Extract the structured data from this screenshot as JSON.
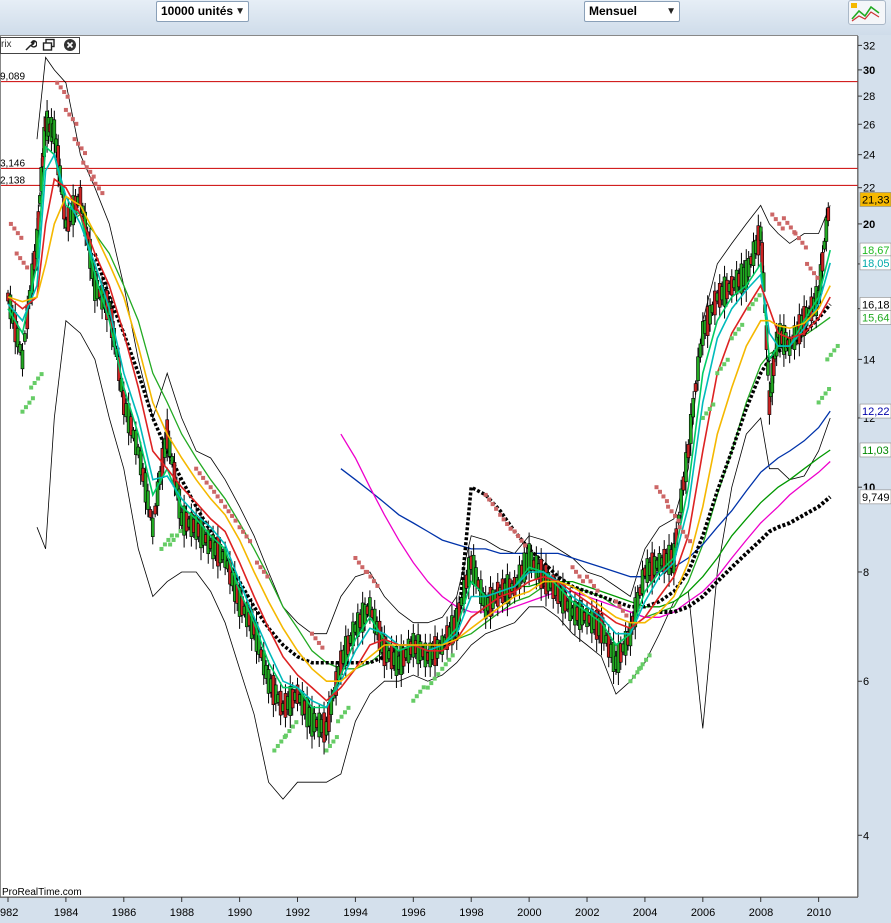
{
  "toolbar": {
    "units_label": "10000 unités",
    "period_label": "Mensuel",
    "dropdown_arrow": "▼",
    "logo_icon": "mini-chart-icon"
  },
  "controls": {
    "label": "rix",
    "icons": [
      "wrench-icon",
      "window-restore-icon",
      "close-circle-icon"
    ]
  },
  "watermark": "ProRealTime.com",
  "chart_data": {
    "type": "line",
    "x_tick_labels": [
      "982",
      "1984",
      "1986",
      "1988",
      "1990",
      "1992",
      "1994",
      "1996",
      "1998",
      "2000",
      "2002",
      "2004",
      "2006",
      "2008",
      "2010"
    ],
    "y_ticks": [
      4,
      6,
      8,
      10,
      12,
      14,
      16,
      18,
      20,
      22,
      24,
      26,
      28,
      30,
      32
    ],
    "y_tick_labels": [
      "4",
      "6",
      "8",
      "10",
      "12",
      "14",
      "",
      "",
      "20",
      "22",
      "24",
      "26",
      "28",
      "30",
      "32"
    ],
    "y_bold_ticks": [
      10,
      20,
      30
    ],
    "xlim": [
      1982,
      2010.6
    ],
    "ylim": [
      3.4,
      32.8
    ],
    "y_scale": "log",
    "horizontal_levels": [
      {
        "value": 29.089,
        "label": "9,089",
        "color": "#cc0000"
      },
      {
        "value": 23.146,
        "label": "3,146",
        "color": "#cc0000"
      },
      {
        "value": 22.138,
        "label": "2,138",
        "color": "#cc0000"
      }
    ],
    "right_badges": [
      {
        "value": 21.33,
        "label": "21,33",
        "bg": "#f5b800",
        "fg": "#000000"
      },
      {
        "value": 18.67,
        "label": "18,67",
        "bg": "#ffffff",
        "fg": "#22bb22"
      },
      {
        "value": 18.05,
        "label": "18,05",
        "bg": "#ffffff",
        "fg": "#00aaaa"
      },
      {
        "value": 16.18,
        "label": "16,18",
        "bg": "#ffffff",
        "fg": "#000000"
      },
      {
        "value": 15.64,
        "label": "15,64",
        "bg": "#ffffff",
        "fg": "#22aa22"
      },
      {
        "value": 12.22,
        "label": "12,22",
        "bg": "#ffffff",
        "fg": "#0000aa"
      },
      {
        "value": 11.03,
        "label": "11,03",
        "bg": "#ffffff",
        "fg": "#008800"
      },
      {
        "value": 9.749,
        "label": "9,749",
        "bg": "#ffffff",
        "fg": "#000000"
      }
    ],
    "price_x": [
      1982.0,
      1982.5,
      1983.0,
      1983.3,
      1983.6,
      1984.0,
      1984.5,
      1985.0,
      1985.5,
      1986.0,
      1986.5,
      1987.0,
      1987.5,
      1988.0,
      1988.5,
      1989.0,
      1989.5,
      1990.0,
      1990.5,
      1991.0,
      1991.5,
      1992.0,
      1992.5,
      1993.0,
      1993.5,
      1994.0,
      1994.5,
      1995.0,
      1995.5,
      1996.0,
      1996.5,
      1997.0,
      1997.5,
      1998.0,
      1998.5,
      1999.0,
      1999.5,
      2000.0,
      2000.5,
      2001.0,
      2001.5,
      2002.0,
      2002.5,
      2003.0,
      2003.5,
      2004.0,
      2004.5,
      2005.0,
      2005.5,
      2006.0,
      2006.5,
      2007.0,
      2007.5,
      2008.0,
      2008.3,
      2008.6,
      2009.0,
      2009.5,
      2010.0,
      2010.4
    ],
    "price_y": [
      16.5,
      14.0,
      19.0,
      26.0,
      25.5,
      20.0,
      21.5,
      17.0,
      16.0,
      12.5,
      11.0,
      9.0,
      11.5,
      9.2,
      9.0,
      8.6,
      8.3,
      7.4,
      6.9,
      6.0,
      5.6,
      5.8,
      5.4,
      5.3,
      6.3,
      6.9,
      7.3,
      6.5,
      6.3,
      6.6,
      6.4,
      6.6,
      7.0,
      8.2,
      7.3,
      7.6,
      7.7,
      8.3,
      7.9,
      7.6,
      7.2,
      7.1,
      6.9,
      6.3,
      6.8,
      8.0,
      8.2,
      8.3,
      11.0,
      15.0,
      16.5,
      17.0,
      17.5,
      19.5,
      12.5,
      15.0,
      14.5,
      15.5,
      16.5,
      21.33
    ],
    "line_series": [
      {
        "color": "#00cc66",
        "values": [
          16.0,
          15.0,
          18.0,
          24.5,
          24.0,
          21.0,
          20.5,
          17.5,
          15.5,
          13.0,
          11.5,
          9.8,
          10.5,
          9.5,
          9.2,
          8.8,
          8.5,
          7.6,
          7.0,
          6.3,
          5.9,
          5.9,
          5.6,
          5.6,
          6.1,
          6.7,
          7.1,
          6.7,
          6.5,
          6.6,
          6.5,
          6.6,
          6.9,
          7.8,
          7.5,
          7.6,
          7.7,
          8.1,
          8.0,
          7.7,
          7.4,
          7.2,
          7.0,
          6.6,
          6.8,
          7.6,
          8.0,
          8.3,
          10.0,
          13.5,
          15.5,
          16.5,
          17.0,
          18.0,
          14.0,
          14.5,
          14.5,
          15.5,
          16.5,
          18.67
        ]
      },
      {
        "color": "#00bbbb",
        "values": [
          16.2,
          15.5,
          17.0,
          23.0,
          24.0,
          21.5,
          20.0,
          18.0,
          16.0,
          13.5,
          12.0,
          10.2,
          10.3,
          9.7,
          9.3,
          9.0,
          8.6,
          7.8,
          7.1,
          6.5,
          6.0,
          5.9,
          5.7,
          5.6,
          6.0,
          6.5,
          6.9,
          6.8,
          6.6,
          6.6,
          6.5,
          6.6,
          6.8,
          7.5,
          7.5,
          7.6,
          7.7,
          8.0,
          8.0,
          7.8,
          7.5,
          7.3,
          7.1,
          6.8,
          6.8,
          7.4,
          7.9,
          8.2,
          9.5,
          12.5,
          14.8,
          16.0,
          16.8,
          17.5,
          15.0,
          14.5,
          14.5,
          15.2,
          16.2,
          18.05
        ]
      },
      {
        "color": "#dd2222",
        "values": [
          16.5,
          16.0,
          16.5,
          20.0,
          22.5,
          22.0,
          20.5,
          18.5,
          17.0,
          15.0,
          13.0,
          11.0,
          10.5,
          10.0,
          9.6,
          9.2,
          8.9,
          8.2,
          7.5,
          6.9,
          6.4,
          6.1,
          5.9,
          5.7,
          5.9,
          6.2,
          6.6,
          6.7,
          6.6,
          6.6,
          6.5,
          6.5,
          6.7,
          7.1,
          7.3,
          7.5,
          7.6,
          7.8,
          7.9,
          7.8,
          7.6,
          7.4,
          7.2,
          7.0,
          6.9,
          7.1,
          7.5,
          7.9,
          8.8,
          11.0,
          13.5,
          15.0,
          16.0,
          17.0,
          16.0,
          15.0,
          14.8,
          15.0,
          15.6,
          16.5
        ]
      },
      {
        "color": "#f5b800",
        "values": [
          16.5,
          16.3,
          16.5,
          18.0,
          20.0,
          21.5,
          21.0,
          19.5,
          18.0,
          16.5,
          14.5,
          12.5,
          11.5,
          10.8,
          10.2,
          9.7,
          9.3,
          8.7,
          8.0,
          7.4,
          6.9,
          6.5,
          6.2,
          6.0,
          6.0,
          6.2,
          6.4,
          6.6,
          6.6,
          6.6,
          6.6,
          6.6,
          6.7,
          6.9,
          7.1,
          7.3,
          7.5,
          7.6,
          7.8,
          7.8,
          7.7,
          7.5,
          7.3,
          7.1,
          7.0,
          7.0,
          7.2,
          7.5,
          8.2,
          9.5,
          11.5,
          13.0,
          14.5,
          15.5,
          15.5,
          15.3,
          15.2,
          15.4,
          16.0,
          17.0
        ]
      },
      {
        "color": "#22aa22",
        "values": [
          null,
          null,
          null,
          null,
          null,
          20.0,
          20.5,
          19.5,
          18.5,
          17.0,
          15.5,
          13.5,
          12.5,
          11.5,
          10.8,
          10.2,
          9.7,
          9.1,
          8.5,
          7.9,
          7.3,
          6.9,
          6.5,
          6.3,
          6.2,
          6.2,
          6.3,
          6.5,
          6.5,
          6.6,
          6.6,
          6.6,
          6.7,
          6.8,
          7.0,
          7.2,
          7.4,
          7.5,
          7.7,
          7.8,
          7.7,
          7.6,
          7.5,
          7.3,
          7.2,
          7.1,
          7.2,
          7.3,
          7.8,
          8.6,
          9.8,
          11.0,
          12.5,
          13.8,
          14.2,
          14.4,
          14.6,
          14.9,
          15.3,
          15.64
        ]
      },
      {
        "color": "#0033aa",
        "values": [
          null,
          null,
          null,
          null,
          null,
          null,
          null,
          null,
          null,
          null,
          null,
          null,
          null,
          null,
          null,
          null,
          null,
          null,
          null,
          null,
          null,
          null,
          null,
          null,
          10.5,
          10.2,
          9.9,
          9.6,
          9.3,
          9.1,
          8.9,
          8.7,
          8.6,
          8.5,
          8.5,
          8.4,
          8.4,
          8.4,
          8.4,
          8.4,
          8.3,
          8.2,
          8.1,
          8.0,
          7.9,
          7.9,
          8.0,
          8.1,
          8.3,
          8.6,
          9.0,
          9.4,
          9.9,
          10.4,
          10.6,
          10.8,
          11.0,
          11.3,
          11.7,
          12.22
        ]
      },
      {
        "color": "#009900",
        "values": [
          null,
          null,
          null,
          null,
          null,
          null,
          null,
          null,
          null,
          null,
          null,
          null,
          null,
          null,
          null,
          null,
          null,
          null,
          null,
          null,
          null,
          null,
          null,
          null,
          null,
          null,
          null,
          null,
          null,
          null,
          null,
          null,
          null,
          null,
          null,
          7.6,
          7.7,
          7.7,
          7.8,
          7.8,
          7.8,
          7.7,
          7.6,
          7.5,
          7.4,
          7.3,
          7.3,
          7.4,
          7.6,
          7.9,
          8.3,
          8.8,
          9.2,
          9.6,
          9.8,
          10.0,
          10.2,
          10.5,
          10.8,
          11.03
        ]
      },
      {
        "color": "#ee00cc",
        "values": [
          null,
          null,
          null,
          null,
          null,
          null,
          null,
          null,
          null,
          null,
          null,
          null,
          null,
          null,
          null,
          null,
          null,
          null,
          null,
          null,
          null,
          null,
          null,
          null,
          11.5,
          10.8,
          10.0,
          9.3,
          8.7,
          8.2,
          7.8,
          7.5,
          7.3,
          7.2,
          7.2,
          7.2,
          7.3,
          7.4,
          7.5,
          7.6,
          7.6,
          7.5,
          7.4,
          7.3,
          7.2,
          7.1,
          7.1,
          7.2,
          7.4,
          7.6,
          7.9,
          8.3,
          8.7,
          9.1,
          9.3,
          9.5,
          9.8,
          10.1,
          10.4,
          10.7
        ]
      }
    ],
    "dashed_ma": {
      "color": "#000000",
      "values": [
        null,
        null,
        null,
        null,
        null,
        null,
        null,
        18.5,
        16.5,
        15.0,
        13.5,
        12.0,
        11.0,
        10.2,
        9.5,
        8.9,
        8.3,
        7.8,
        7.3,
        6.9,
        6.6,
        6.4,
        6.3,
        6.3,
        6.3,
        6.3,
        6.3,
        6.4,
        6.4,
        6.5,
        6.5,
        6.6,
        6.7,
        10.0,
        9.8,
        9.4,
        8.9,
        8.5,
        8.2,
        7.9,
        7.7,
        7.6,
        7.5,
        7.4,
        7.3,
        7.3,
        7.4,
        7.6,
        8.0,
        8.8,
        9.9,
        11.0,
        12.3,
        13.5,
        14.0,
        14.3,
        14.5,
        15.0,
        15.6,
        16.18
      ]
    },
    "slow_ma": {
      "color": "#000000",
      "values": [
        null,
        null,
        null,
        null,
        null,
        null,
        null,
        null,
        null,
        null,
        null,
        null,
        null,
        null,
        null,
        null,
        null,
        null,
        null,
        null,
        null,
        null,
        null,
        null,
        null,
        null,
        null,
        null,
        null,
        null,
        null,
        null,
        null,
        null,
        null,
        null,
        null,
        null,
        null,
        null,
        null,
        null,
        null,
        null,
        null,
        null,
        7.2,
        7.2,
        7.3,
        7.5,
        7.8,
        8.1,
        8.4,
        8.7,
        8.9,
        9.0,
        9.1,
        9.3,
        9.5,
        9.749
      ]
    },
    "bollinger_upper": [
      null,
      null,
      25.0,
      31.0,
      30.0,
      29.0,
      24.0,
      22.0,
      20.0,
      17.0,
      14.0,
      12.0,
      13.5,
      12.0,
      11.0,
      10.8,
      10.2,
      9.5,
      8.8,
      8.0,
      7.3,
      7.0,
      6.8,
      6.8,
      7.5,
      7.9,
      8.0,
      7.5,
      7.2,
      7.0,
      7.0,
      7.1,
      7.5,
      8.8,
      8.7,
      8.5,
      8.4,
      8.8,
      8.7,
      8.5,
      8.3,
      8.0,
      7.9,
      7.7,
      7.5,
      8.5,
      9.0,
      9.2,
      10.5,
      15.5,
      18.0,
      19.0,
      20.0,
      21.0,
      20.0,
      19.5,
      19.0,
      19.5,
      19.5,
      21.0
    ],
    "bollinger_lower": [
      null,
      null,
      9.0,
      8.5,
      12.0,
      15.5,
      15.0,
      14.0,
      12.0,
      10.5,
      8.5,
      7.5,
      7.8,
      8.0,
      8.0,
      7.6,
      7.0,
      6.2,
      5.5,
      4.6,
      4.4,
      4.6,
      4.6,
      4.6,
      4.7,
      5.4,
      5.8,
      6.0,
      6.0,
      6.1,
      6.0,
      6.1,
      6.3,
      6.6,
      6.8,
      6.9,
      7.0,
      7.3,
      7.3,
      7.1,
      6.8,
      6.6,
      6.4,
      5.8,
      6.0,
      6.3,
      6.8,
      7.4,
      7.6,
      5.3,
      8.0,
      10.0,
      11.5,
      12.0,
      10.5,
      10.5,
      10.2,
      10.3,
      11.0,
      12.0
    ],
    "parabolic_sar": {
      "red_color": "#cc6666",
      "green_color": "#66cc66",
      "points": [
        {
          "x": 1982.1,
          "y": 20.0,
          "c": "red"
        },
        {
          "x": 1982.3,
          "y": 18.5,
          "c": "red"
        },
        {
          "x": 1982.5,
          "y": 12.2,
          "c": "green"
        },
        {
          "x": 1982.8,
          "y": 13.0,
          "c": "green"
        },
        {
          "x": 1983.7,
          "y": 29.0,
          "c": "red"
        },
        {
          "x": 1984.0,
          "y": 27.0,
          "c": "red"
        },
        {
          "x": 1984.3,
          "y": 25.0,
          "c": "red"
        },
        {
          "x": 1984.6,
          "y": 23.5,
          "c": "red"
        },
        {
          "x": 1984.9,
          "y": 22.5,
          "c": "red"
        },
        {
          "x": 1987.3,
          "y": 8.5,
          "c": "green"
        },
        {
          "x": 1987.6,
          "y": 8.6,
          "c": "green"
        },
        {
          "x": 1988.5,
          "y": 10.5,
          "c": "red"
        },
        {
          "x": 1989.0,
          "y": 10.0,
          "c": "red"
        },
        {
          "x": 1989.5,
          "y": 9.5,
          "c": "red"
        },
        {
          "x": 1990.0,
          "y": 9.0,
          "c": "red"
        },
        {
          "x": 1990.6,
          "y": 8.2,
          "c": "red"
        },
        {
          "x": 1991.2,
          "y": 5.0,
          "c": "green"
        },
        {
          "x": 1991.6,
          "y": 5.2,
          "c": "green"
        },
        {
          "x": 1992.5,
          "y": 6.8,
          "c": "red"
        },
        {
          "x": 1993.0,
          "y": 5.0,
          "c": "green"
        },
        {
          "x": 1993.4,
          "y": 5.4,
          "c": "green"
        },
        {
          "x": 1994.0,
          "y": 8.3,
          "c": "red"
        },
        {
          "x": 1994.4,
          "y": 8.0,
          "c": "red"
        },
        {
          "x": 1996.0,
          "y": 5.7,
          "c": "green"
        },
        {
          "x": 1996.5,
          "y": 5.9,
          "c": "green"
        },
        {
          "x": 1997.0,
          "y": 6.2,
          "c": "green"
        },
        {
          "x": 1998.5,
          "y": 9.8,
          "c": "red"
        },
        {
          "x": 1999.0,
          "y": 9.3,
          "c": "red"
        },
        {
          "x": 1999.5,
          "y": 8.9,
          "c": "red"
        },
        {
          "x": 2001.5,
          "y": 8.1,
          "c": "red"
        },
        {
          "x": 2002.0,
          "y": 7.9,
          "c": "red"
        },
        {
          "x": 2003.0,
          "y": 7.4,
          "c": "red"
        },
        {
          "x": 2003.5,
          "y": 6.0,
          "c": "green"
        },
        {
          "x": 2003.8,
          "y": 6.2,
          "c": "green"
        },
        {
          "x": 2004.4,
          "y": 10.0,
          "c": "red"
        },
        {
          "x": 2004.8,
          "y": 9.5,
          "c": "red"
        },
        {
          "x": 2005.2,
          "y": 9.0,
          "c": "red"
        },
        {
          "x": 2006.0,
          "y": 12.0,
          "c": "green"
        },
        {
          "x": 2006.5,
          "y": 13.5,
          "c": "green"
        },
        {
          "x": 2007.0,
          "y": 14.8,
          "c": "green"
        },
        {
          "x": 2007.6,
          "y": 16.0,
          "c": "green"
        },
        {
          "x": 2008.4,
          "y": 20.5,
          "c": "red"
        },
        {
          "x": 2008.8,
          "y": 20.3,
          "c": "red"
        },
        {
          "x": 2009.2,
          "y": 19.5,
          "c": "red"
        },
        {
          "x": 2009.6,
          "y": 18.0,
          "c": "red"
        },
        {
          "x": 2010.0,
          "y": 12.5,
          "c": "green"
        },
        {
          "x": 2010.3,
          "y": 14.0,
          "c": "green"
        }
      ]
    },
    "grid": false,
    "legend": "none"
  }
}
